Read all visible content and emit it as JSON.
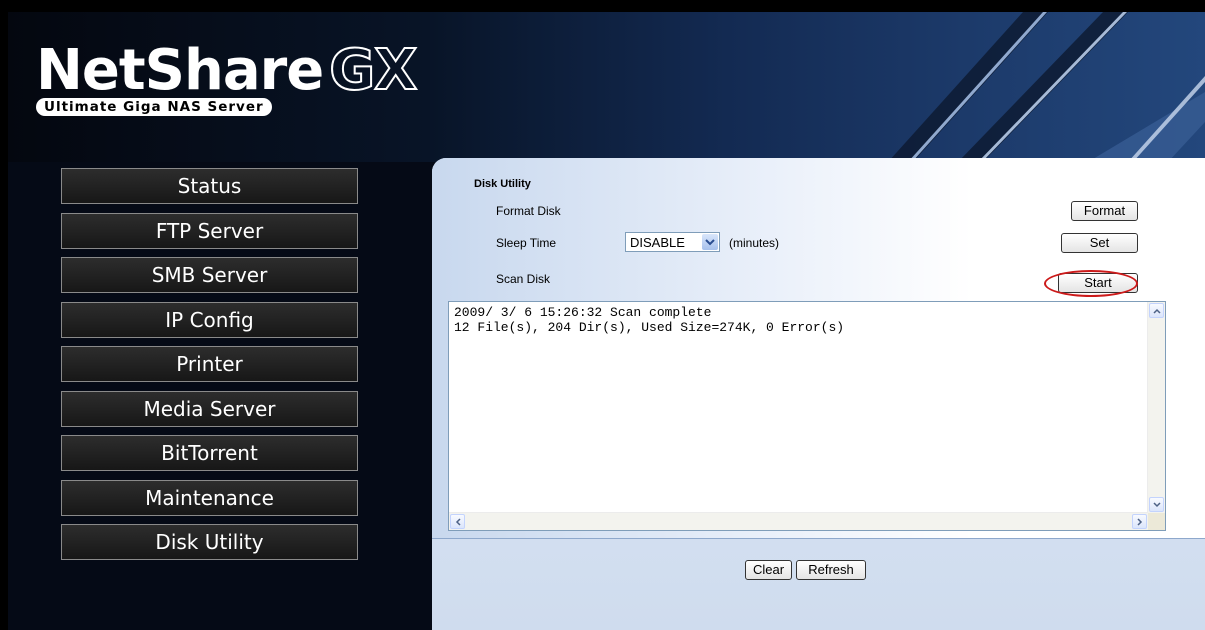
{
  "logo": {
    "main": "NetShare",
    "suffix": "GX",
    "tagline": "Ultimate Giga NAS Server"
  },
  "nav": {
    "items": [
      {
        "label": "Status"
      },
      {
        "label": "FTP Server"
      },
      {
        "label": "SMB Server"
      },
      {
        "label": "IP Config"
      },
      {
        "label": "Printer"
      },
      {
        "label": "Media Server"
      },
      {
        "label": "BitTorrent"
      },
      {
        "label": "Maintenance"
      },
      {
        "label": "Disk Utility"
      }
    ]
  },
  "disk_utility": {
    "title": "Disk Utility",
    "format_label": "Format Disk",
    "format_button": "Format",
    "sleep_label": "Sleep Time",
    "sleep_value": "DISABLE",
    "sleep_unit": "(minutes)",
    "set_button": "Set",
    "scan_label": "Scan Disk",
    "start_button": "Start",
    "log_lines": [
      "2009/ 3/ 6 15:26:32 Scan complete",
      "12 File(s), 204 Dir(s), Used Size=274K, 0 Error(s)"
    ],
    "clear_button": "Clear",
    "refresh_button": "Refresh"
  },
  "colors": {
    "highlight": "#cc1a1a",
    "panel_bg": "#dfe9f7",
    "nav_border": "#8a8a8a"
  }
}
